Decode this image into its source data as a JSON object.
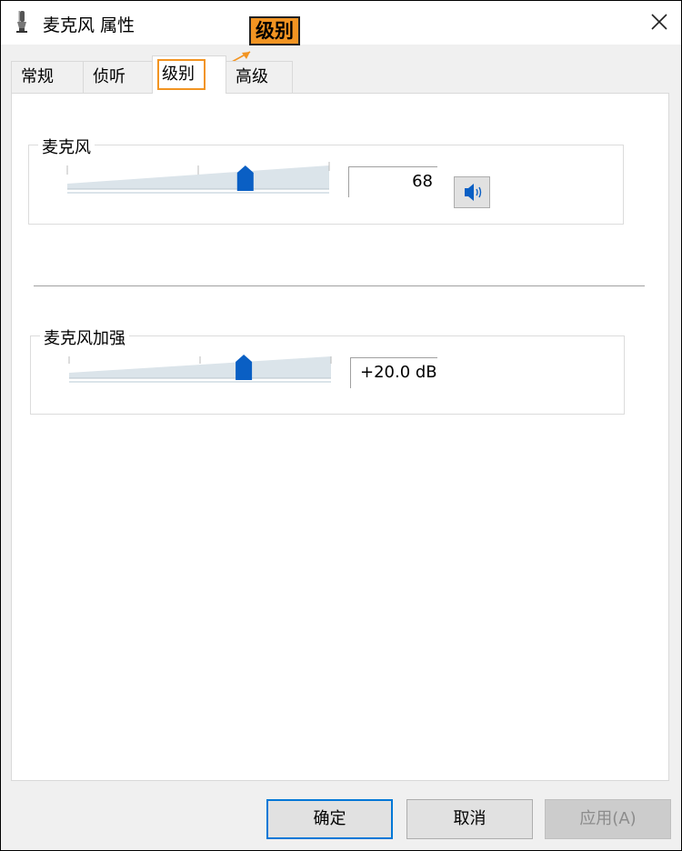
{
  "window": {
    "title": "麦克风 属性",
    "icon": "microphone-icon",
    "close_icon": "close-icon"
  },
  "annotation": {
    "label": "级别",
    "color": "#f29422"
  },
  "tabs": [
    {
      "label": "常规",
      "active": false
    },
    {
      "label": "侦听",
      "active": false
    },
    {
      "label": "级别",
      "active": true
    },
    {
      "label": "高级",
      "active": false
    }
  ],
  "levels": {
    "microphone": {
      "label": "麦克风",
      "value": "68",
      "level_fraction": 0.68,
      "speaker_icon": "speaker-icon"
    },
    "boost": {
      "label": "麦克风加强",
      "value": "+20.0 dB",
      "level_fraction": 0.667
    }
  },
  "buttons": {
    "ok": "确定",
    "cancel": "取消",
    "apply": "应用(A)"
  },
  "colors": {
    "accent": "#0078d7",
    "annotation": "#f29422"
  }
}
